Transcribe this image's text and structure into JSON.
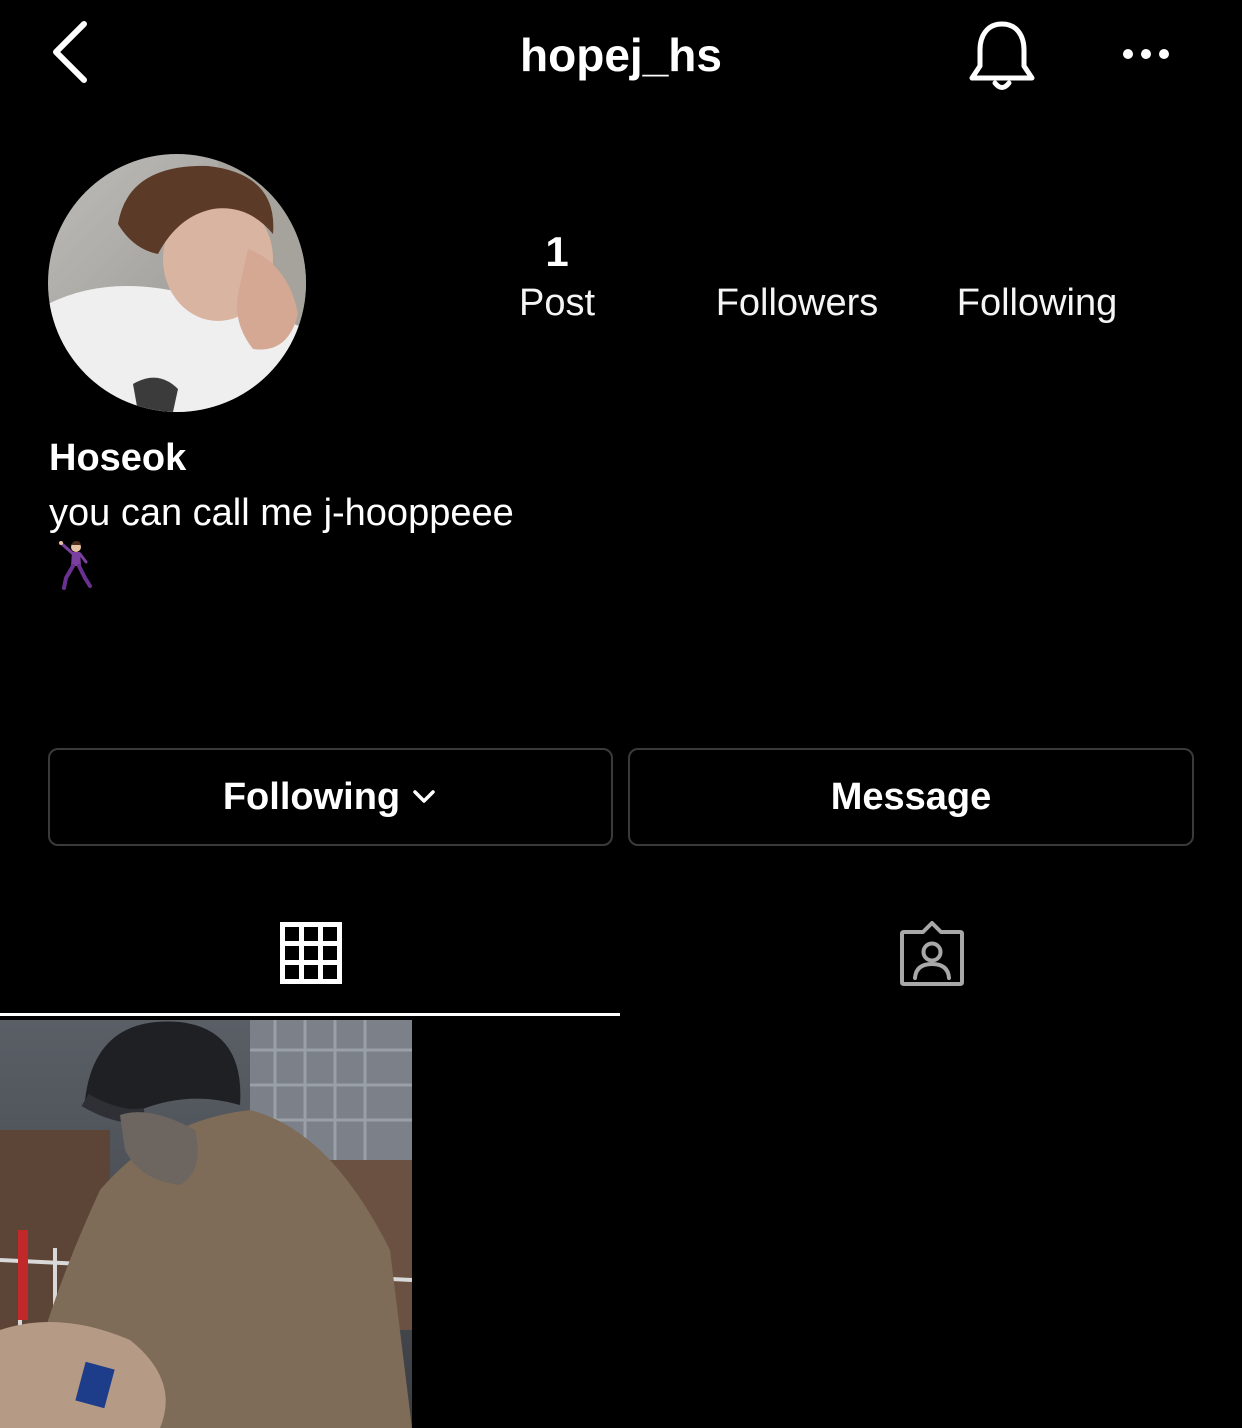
{
  "header": {
    "username": "hopej_hs",
    "back_icon": "chevron-left-icon",
    "bell_icon": "bell-icon",
    "more_icon": "more-horizontal-icon"
  },
  "profile": {
    "display_name": "Hoseok",
    "bio": "you can call me j-hooppeee",
    "bio_emoji": "man-dancing-emoji"
  },
  "stats": {
    "posts": {
      "count": "1",
      "label": "Post"
    },
    "followers": {
      "count": "",
      "label": "Followers"
    },
    "following": {
      "count": "",
      "label": "Following"
    }
  },
  "actions": {
    "following_label": "Following",
    "message_label": "Message"
  },
  "tabs": {
    "active": "grid",
    "grid_icon": "grid-icon",
    "tagged_icon": "tagged-person-icon"
  },
  "colors": {
    "background": "#000000",
    "text": "#ffffff",
    "button_border": "#3a3a3a"
  }
}
